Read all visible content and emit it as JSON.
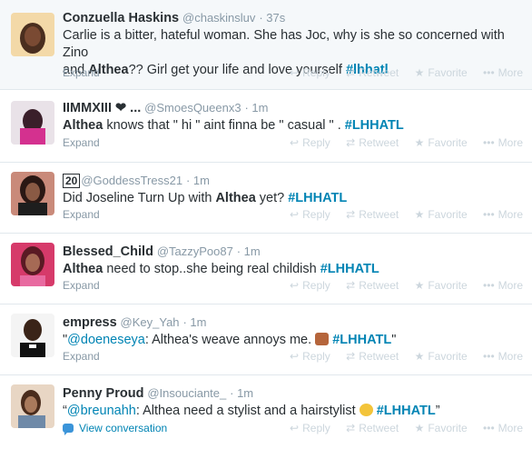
{
  "tweets": [
    {
      "fullname": "Conzuella Haskins",
      "username": "@chaskinsluv",
      "time": "· 37s",
      "text1": "Carlie is a bitter, hateful woman. She has Joc, why is she so concerned with Zino",
      "text2a": "and ",
      "text2b": "Althea",
      "text2c": "?? Girl get your life and love yourself ",
      "hashtag": "#lhhatl",
      "footer_link": "Expand"
    },
    {
      "fullname": "IIMMXIII ❤ ...",
      "username": "@SmoesQueenx3",
      "time": "· 1m",
      "bold": "Althea",
      "text": " knows that \" hi \" aint finna be \" casual \" . ",
      "hashtag": "#LHHATL",
      "footer_link": "Expand"
    },
    {
      "fullname_box": "20",
      "username": "@GoddessTress21",
      "time": "· 1m",
      "text": "Did Joseline Turn Up with ",
      "bold": "Althea",
      "text_after": " yet? ",
      "hashtag": "#LHHATL",
      "footer_link": "Expand"
    },
    {
      "fullname": "Blessed_Child",
      "username": "@TazzyPoo87",
      "time": "· 1m",
      "bold": "Althea",
      "text": " need to stop..she being real childish ",
      "hashtag": "#LHHATL",
      "footer_link": "Expand"
    },
    {
      "fullname": "empress",
      "username": "@Key_Yah",
      "time": "· 1m",
      "quote_open": "\"",
      "mention": "@doeneseya",
      "text": ": Althea's weave annoys me. ",
      "hashtag": "#LHHATL",
      "quote_close": "\"",
      "footer_link": "Expand"
    },
    {
      "fullname": "Penny Proud",
      "username": "@Insouciante_",
      "time": "· 1m",
      "quote_open": "“",
      "mention": "@breunahh",
      "text": ": Althea need a stylist and a hairstylist ",
      "hashtag": "#LHHATL",
      "quote_close": "”",
      "footer_link": "View conversation"
    }
  ],
  "actions": {
    "reply": "Reply",
    "retweet": "Retweet",
    "favorite": "Favorite",
    "more": "More"
  },
  "icons": {
    "reply": "reply-arrow-icon",
    "retweet": "retweet-icon",
    "favorite": "star-icon",
    "more": "more-dots-icon",
    "conversation": "speech-bubble-icon"
  },
  "colors": {
    "link": "#0084b4",
    "muted": "#8899a6",
    "action": "#ccd6dd"
  }
}
